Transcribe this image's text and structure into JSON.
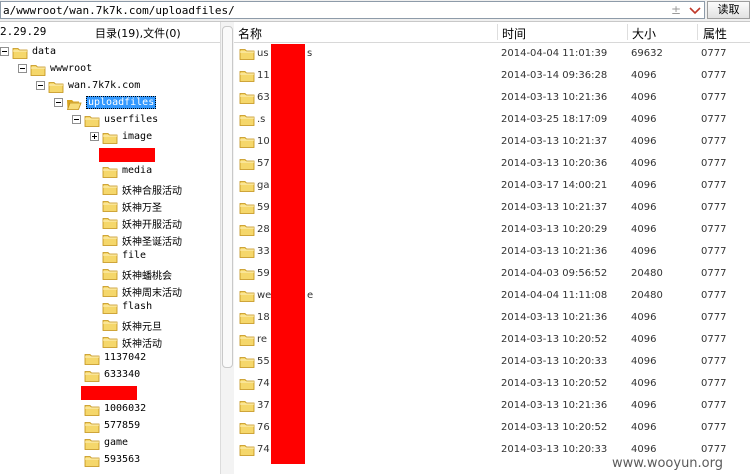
{
  "address_bar": {
    "path": "a/wwwroot/wan.7k7k.com/uploadfiles/",
    "plus_icon": "±",
    "read_button": "读取"
  },
  "left_panel": {
    "ip_fragment": "2.29.29",
    "summary": "目录(19),文件(0)",
    "tree": [
      {
        "label": "data",
        "depth": 0,
        "expander": "minus",
        "mono": true
      },
      {
        "label": "wwwroot",
        "depth": 1,
        "expander": "minus",
        "mono": true
      },
      {
        "label": "wan.7k7k.com",
        "depth": 2,
        "expander": "minus",
        "mono": true
      },
      {
        "label": "uploadfiles",
        "depth": 3,
        "expander": "minus",
        "selected": true,
        "open": true,
        "mono": true
      },
      {
        "label": "userfiles",
        "depth": 4,
        "expander": "minus",
        "mono": true
      },
      {
        "label": "image",
        "depth": 5,
        "expander": "plus",
        "mono": true
      },
      {
        "label": "",
        "depth": 5,
        "redacted": true
      },
      {
        "label": "media",
        "depth": 5,
        "mono": true
      },
      {
        "label": "妖神合服活动",
        "depth": 5
      },
      {
        "label": "妖神万圣",
        "depth": 5
      },
      {
        "label": "妖神开服活动",
        "depth": 5
      },
      {
        "label": "妖神圣诞活动",
        "depth": 5
      },
      {
        "label": "file",
        "depth": 5,
        "mono": true
      },
      {
        "label": "妖神蟠桃会",
        "depth": 5
      },
      {
        "label": "妖神周末活动",
        "depth": 5
      },
      {
        "label": "flash",
        "depth": 5,
        "mono": true
      },
      {
        "label": "妖神元旦",
        "depth": 5
      },
      {
        "label": "妖神活动",
        "depth": 5
      },
      {
        "label": "1137042",
        "depth": 4,
        "mono": true
      },
      {
        "label": "633340",
        "depth": 4,
        "mono": true
      },
      {
        "label": "",
        "depth": 4,
        "redacted": true
      },
      {
        "label": "1006032",
        "depth": 4,
        "mono": true
      },
      {
        "label": "577859",
        "depth": 4,
        "mono": true
      },
      {
        "label": "game",
        "depth": 4,
        "mono": true
      },
      {
        "label": "593563",
        "depth": 4,
        "mono": true
      }
    ]
  },
  "columns": {
    "name": "名称",
    "time": "时间",
    "size": "大小",
    "attr": "属性"
  },
  "files": [
    {
      "name": "us",
      "name_tail": "s",
      "time": "2014-04-04 11:01:39",
      "size": "69632",
      "attr": "0777"
    },
    {
      "name": "11",
      "time": "2014-03-14 09:36:28",
      "size": "4096",
      "attr": "0777"
    },
    {
      "name": "63",
      "time": "2014-03-13 10:21:36",
      "size": "4096",
      "attr": "0777"
    },
    {
      "name": ".s",
      "time": "2014-03-25 18:17:09",
      "size": "4096",
      "attr": "0777"
    },
    {
      "name": "10",
      "time": "2014-03-13 10:21:37",
      "size": "4096",
      "attr": "0777"
    },
    {
      "name": "57",
      "time": "2014-03-13 10:20:36",
      "size": "4096",
      "attr": "0777"
    },
    {
      "name": "ga",
      "time": "2014-03-17 14:00:21",
      "size": "4096",
      "attr": "0777"
    },
    {
      "name": "59",
      "time": "2014-03-13 10:21:37",
      "size": "4096",
      "attr": "0777"
    },
    {
      "name": "28",
      "time": "2014-03-13 10:20:29",
      "size": "4096",
      "attr": "0777"
    },
    {
      "name": "33",
      "time": "2014-03-13 10:21:36",
      "size": "4096",
      "attr": "0777"
    },
    {
      "name": "59",
      "time": "2014-04-03 09:56:52",
      "size": "20480",
      "attr": "0777"
    },
    {
      "name": "we",
      "name_tail": "e",
      "time": "2014-04-04 11:11:08",
      "size": "20480",
      "attr": "0777"
    },
    {
      "name": "18",
      "time": "2014-03-13 10:21:36",
      "size": "4096",
      "attr": "0777"
    },
    {
      "name": "re",
      "time": "2014-03-13 10:20:52",
      "size": "4096",
      "attr": "0777"
    },
    {
      "name": "55",
      "time": "2014-03-13 10:20:33",
      "size": "4096",
      "attr": "0777"
    },
    {
      "name": "74",
      "time": "2014-03-13 10:20:52",
      "size": "4096",
      "attr": "0777"
    },
    {
      "name": "37",
      "time": "2014-03-13 10:21:36",
      "size": "4096",
      "attr": "0777"
    },
    {
      "name": "76",
      "time": "2014-03-13 10:20:52",
      "size": "4096",
      "attr": "0777"
    },
    {
      "name": "74",
      "time": "2014-03-13 10:20:33",
      "size": "4096",
      "attr": "0777"
    }
  ],
  "watermark": "www.wooyun.org",
  "colors": {
    "folder": "#f5d76b",
    "folder_dark": "#d9a520",
    "redaction": "#ff0000",
    "selection": "#3399ff"
  }
}
